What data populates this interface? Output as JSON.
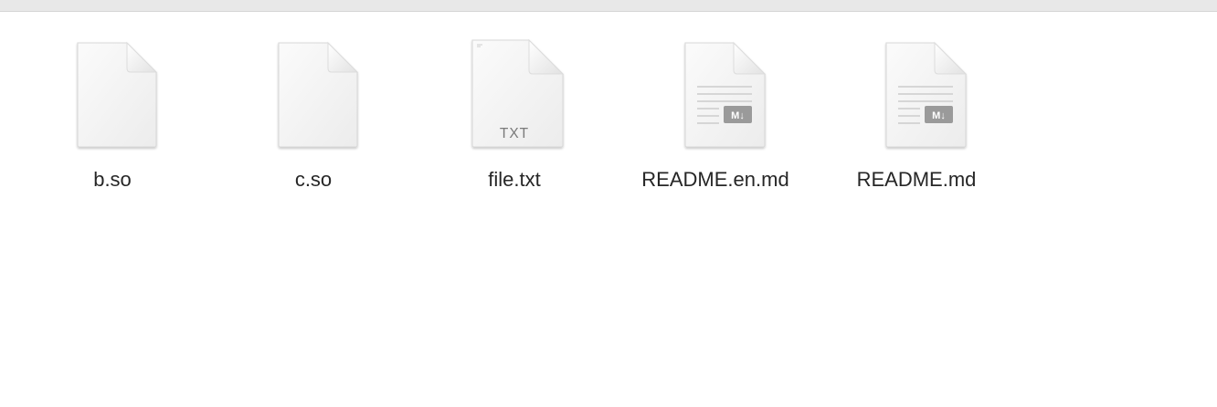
{
  "files": [
    {
      "name": "b.so",
      "type": "generic",
      "icon": "generic-document-icon"
    },
    {
      "name": "c.so",
      "type": "generic",
      "icon": "generic-document-icon"
    },
    {
      "name": "file.txt",
      "type": "txt",
      "icon": "text-document-icon",
      "badge": "TXT"
    },
    {
      "name": "README.en.md",
      "type": "markdown",
      "icon": "markdown-document-icon",
      "badge": "M↓"
    },
    {
      "name": "README.md",
      "type": "markdown",
      "icon": "markdown-document-icon",
      "badge": "M↓"
    }
  ],
  "colors": {
    "label": "#262626",
    "icon_fill": "#f6f6f6",
    "icon_border": "#d9d9d9",
    "badge": "#9a9a9a",
    "top_bar": "#e8e8e8"
  }
}
